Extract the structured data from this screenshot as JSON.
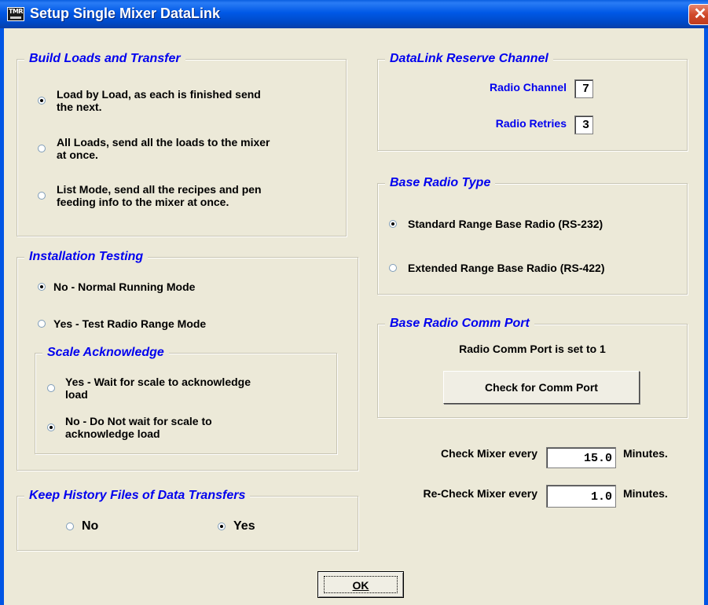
{
  "window": {
    "title": "Setup Single Mixer DataLink",
    "icon_text": "TMR",
    "close_glyph": "✕"
  },
  "build_loads": {
    "title": "Build Loads and Transfer",
    "options": [
      {
        "line1": "Load by Load, as each is finished send",
        "line2": "the next.",
        "checked": true
      },
      {
        "line1": "All Loads, send all the loads to the mixer",
        "line2": "at once.",
        "checked": false
      },
      {
        "line1": "List Mode, send all the recipes and pen",
        "line2": "feeding info to the mixer at once.",
        "checked": false
      }
    ]
  },
  "installation_testing": {
    "title": "Installation Testing",
    "options": [
      {
        "label": "No - Normal Running Mode",
        "checked": true
      },
      {
        "label": "Yes - Test Radio Range Mode",
        "checked": false
      }
    ],
    "scale_ack": {
      "title": "Scale Acknowledge",
      "options": [
        {
          "line1": "Yes - Wait for scale to acknowledge",
          "line2": "load",
          "checked": false
        },
        {
          "line1": "No - Do Not wait for scale to",
          "line2": "acknowledge load",
          "checked": true
        }
      ]
    }
  },
  "history": {
    "title": "Keep History Files of Data Transfers",
    "options": [
      {
        "label": "No",
        "checked": false
      },
      {
        "label": "Yes",
        "checked": true
      }
    ]
  },
  "reserve_channel": {
    "title": "DataLink Reserve Channel",
    "radio_channel_label": "Radio Channel",
    "radio_channel_value": "7",
    "radio_retries_label": "Radio Retries",
    "radio_retries_value": "3"
  },
  "base_radio_type": {
    "title": "Base Radio Type",
    "options": [
      {
        "label": "Standard Range Base Radio (RS-232)",
        "checked": true
      },
      {
        "label": "Extended Range Base Radio (RS-422)",
        "checked": false
      }
    ]
  },
  "comm_port": {
    "title": "Base Radio Comm Port",
    "status": "Radio Comm Port is set to 1",
    "button_label": "Check for Comm Port"
  },
  "check_mixer": {
    "label": "Check Mixer every",
    "value": "15.0",
    "unit": "Minutes."
  },
  "recheck_mixer": {
    "label": "Re-Check Mixer every",
    "value": "1.0",
    "unit": "Minutes."
  },
  "ok_button": {
    "label": "OK"
  },
  "colors": {
    "group_title": "#0000EE",
    "face": "#ECE9D8",
    "titlebar": "#0058E6"
  }
}
